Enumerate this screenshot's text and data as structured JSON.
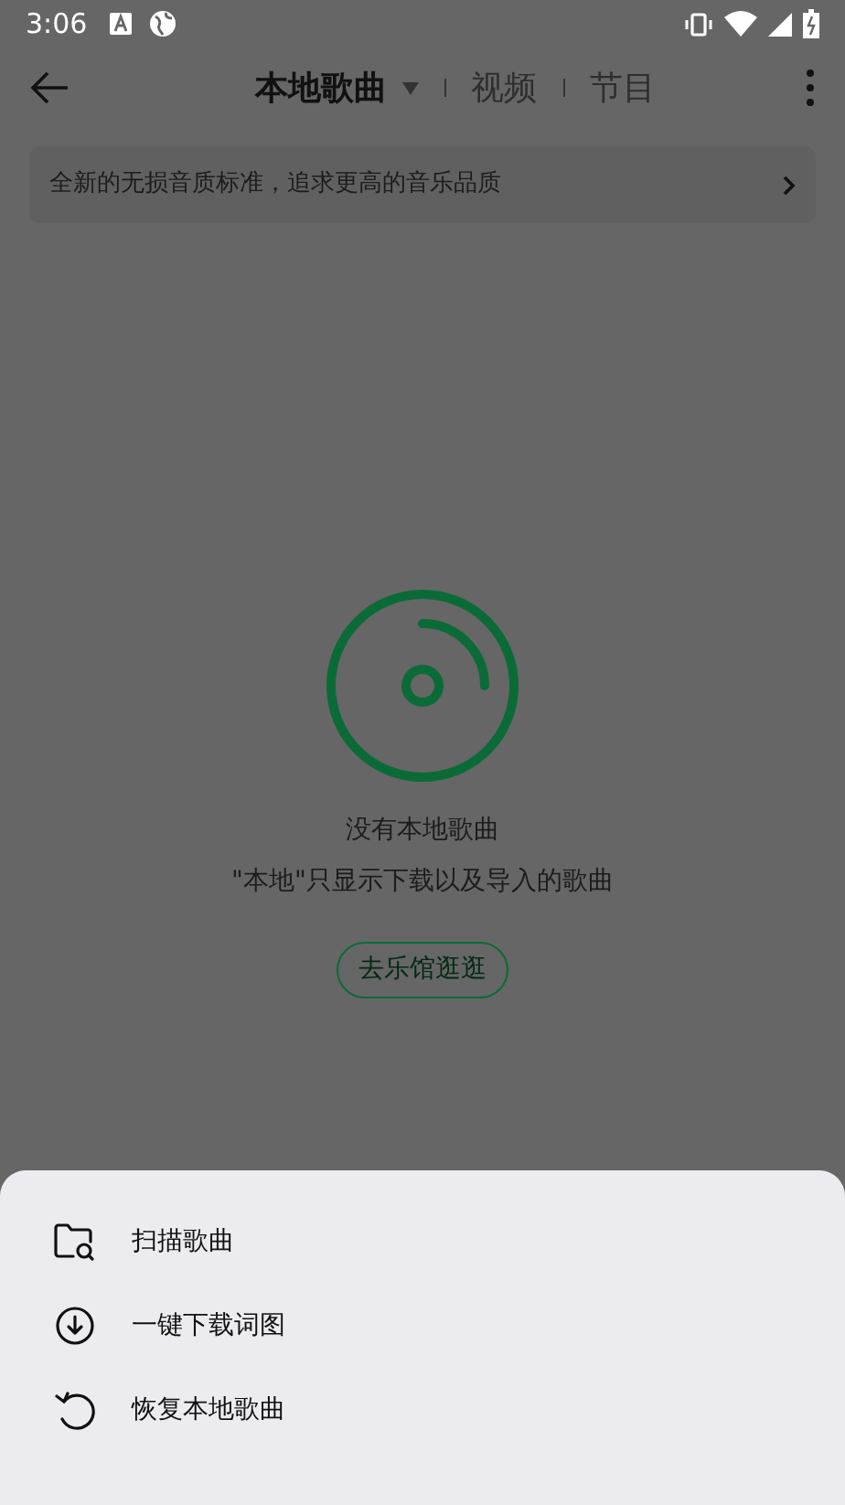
{
  "status_bar": {
    "time": "3:06"
  },
  "tabs": [
    {
      "label": "本地歌曲",
      "selected": true
    },
    {
      "label": "视频",
      "selected": false
    },
    {
      "label": "节目",
      "selected": false
    }
  ],
  "banner": {
    "text": "全新的无损音质标准，追求更高的音乐品质"
  },
  "empty_state": {
    "title": "没有本地歌曲",
    "subtitle": "\"本地\"只显示下载以及导入的歌曲",
    "button": "去乐馆逛逛"
  },
  "sheet": {
    "items": [
      {
        "kind": "scan",
        "label": "扫描歌曲"
      },
      {
        "kind": "download",
        "label": "一键下载词图"
      },
      {
        "kind": "restore",
        "label": "恢复本地歌曲"
      }
    ]
  }
}
